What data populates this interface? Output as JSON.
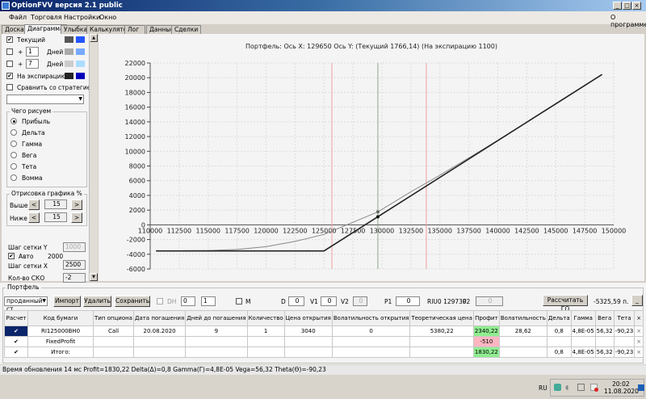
{
  "window": {
    "title": "OptionFVV версия 2.1 public"
  },
  "menu": {
    "items": [
      "Файл",
      "Торговля",
      "Настройки",
      "Окно"
    ],
    "about": "О программе"
  },
  "tabs": [
    "Доска",
    "Диаграмма",
    "Улыбка",
    "Калькулятор",
    "Лог",
    "Данные",
    "Сделки"
  ],
  "active_tab": "Диаграмма",
  "left_panel": {
    "current": {
      "label": "Текущий",
      "checked": true,
      "colors": [
        "#555555",
        "#2255ff"
      ]
    },
    "plus1": {
      "sign": "+",
      "days": "1",
      "days_label": "Дней",
      "checked": false,
      "colors": [
        "#aaaaaa",
        "#77aaff"
      ]
    },
    "plus7": {
      "sign": "+",
      "days": "7",
      "days_label": "Дней",
      "checked": false,
      "colors": [
        "#cccccc",
        "#aaddff"
      ]
    },
    "expiration": {
      "label": "На экспирацию",
      "checked": true,
      "colors": [
        "#222222",
        "#0000bb"
      ]
    },
    "compare": {
      "label": "Сравнить со стратегией",
      "checked": false
    },
    "draw_group": {
      "title": "Чего рисуем",
      "options": [
        "Прибыль",
        "Дельта",
        "Гамма",
        "Вега",
        "Тета",
        "Вомма"
      ],
      "selected": "Прибыль"
    },
    "range_group": {
      "title": "Отрисовка графика %",
      "above_label": "Выше",
      "above": "15",
      "below_label": "Ниже",
      "below": "15",
      "dec": "<",
      "inc": ">"
    },
    "grid_y_label": "Шаг сетки Y",
    "grid_y": "1000",
    "auto_label": "Авто",
    "auto_checked": true,
    "auto_value": "2000",
    "grid_x_label": "Шаг сетки X",
    "grid_x": "2500",
    "sko_label": "Кол-во СКО",
    "sko": "-2"
  },
  "chart_data": {
    "type": "line",
    "title": "Портфель: Ось X:  129650 Ось Y:   (Текущий 1766,14)   (На экспирацию  1100)",
    "xlim": [
      110000,
      150000
    ],
    "ylim": [
      -6000,
      22000
    ],
    "xticks": [
      110000,
      112500,
      115000,
      117500,
      120000,
      122500,
      125000,
      127500,
      130000,
      132500,
      135000,
      137500,
      140000,
      142500,
      145000,
      147500,
      150000
    ],
    "yticks": [
      22000,
      20000,
      18000,
      16000,
      14000,
      12000,
      10000,
      8000,
      6000,
      4000,
      2000,
      0,
      -2000,
      -4000,
      -6000
    ],
    "grid": true,
    "series": [
      {
        "name": "Текущий",
        "color": "#888888",
        "x": [
          110500,
          115000,
          117500,
          120000,
          122500,
          125000,
          127500,
          129650,
          132500,
          135000,
          137500,
          140000,
          145000,
          149000
        ],
        "y": [
          -3550,
          -3500,
          -3350,
          -2970,
          -2250,
          -1300,
          350,
          1766,
          4500,
          6750,
          9100,
          11500,
          16400,
          20400
        ]
      },
      {
        "name": "На экспирацию",
        "color": "#222222",
        "x": [
          110500,
          125000,
          129650,
          149000
        ],
        "y": [
          -3550,
          -3550,
          1100,
          20450
        ]
      }
    ],
    "cursor_x": 129650,
    "sd_lines": [
      125680,
      133830
    ],
    "colors": {
      "cursor": "#8aa88a",
      "sd": "#f0a0a0"
    }
  },
  "portfolio": {
    "title": "Портфель",
    "select": "проданный ст",
    "buttons": {
      "import": "Импорт",
      "delete": "Удалить",
      "save": "Сохранить",
      "calc_go": "Рассчитать ГО",
      "min": "_"
    },
    "dh_label": "DH",
    "dh1": "0",
    "dh2": "1",
    "m_label": "M",
    "d_label": "D",
    "d": "0",
    "v1_label": "V1",
    "v1": "0",
    "v2_label": "V2",
    "v2": "0",
    "p1_label": "P1",
    "p1": "0",
    "riu": "RIU0 129730",
    "p2_label": "P2",
    "p2": "0",
    "go_value": "-5325,59 п.",
    "columns": [
      "Расчет",
      "Код бумаги",
      "Тип опциона",
      "Дата погашения",
      "Дней до погашения",
      "Количество",
      "Цена открытия",
      "Волатильность открытия",
      "Теоретическая цена",
      "Профит",
      "Волатильность",
      "Дельта",
      "Гамма",
      "Вега",
      "Тета",
      "×"
    ],
    "rows": [
      [
        "✔",
        "RI125000BH0",
        "Call",
        "20.08.2020",
        "9",
        "1",
        "3040",
        "0",
        "5380,22",
        "2340,22",
        "28,62",
        "0,8",
        "4,8E-05",
        "56,32",
        "-90,23",
        "×"
      ],
      [
        "✔",
        "FixedProfit",
        "",
        "",
        "",
        "",
        "",
        "",
        "",
        "-510",
        "",
        "",
        "",
        "",
        "",
        "×"
      ],
      [
        "✔",
        "Итого:",
        "",
        "",
        "",
        "",
        "",
        "",
        "",
        "1830,22",
        "",
        "0,8",
        "4,8E-05",
        "56,32",
        "-90,23",
        "×"
      ]
    ]
  },
  "status": "Время обновления 14 мс  Profit=1830,22 Delta(Δ)=0,8 Gamma(Γ)=4,8E-05 Vega=56,32 Theta(Θ)=-90,23",
  "taskbar": {
    "lang": "RU",
    "time": "20:02",
    "date": "11.08.2020"
  }
}
